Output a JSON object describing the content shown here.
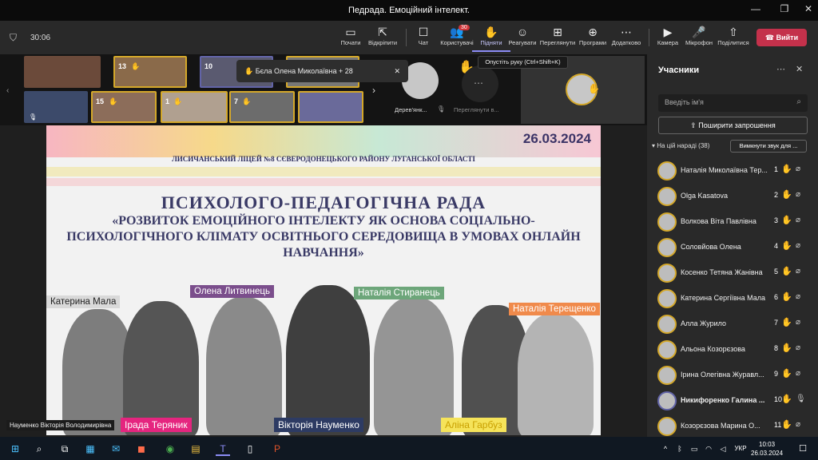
{
  "window": {
    "title": "Педрада. Емоційний інтелект.",
    "minimize": "—",
    "restore": "❐",
    "close": "✕"
  },
  "meeting": {
    "timer": "30:06"
  },
  "toolbar": {
    "items": [
      {
        "label": "Почати",
        "icon": "▭"
      },
      {
        "label": "Відкріпити",
        "icon": "⇱"
      },
      {
        "label": "Чат",
        "icon": "☐"
      },
      {
        "label": "Користувачі",
        "icon": "👥",
        "badge": "30"
      },
      {
        "label": "Підняти",
        "icon": "✋"
      },
      {
        "label": "Реагувати",
        "icon": "☺"
      },
      {
        "label": "Переглянути",
        "icon": "⊞"
      },
      {
        "label": "Програми",
        "icon": "⊕"
      },
      {
        "label": "Додатково",
        "icon": "⋯"
      },
      {
        "label": "Камера",
        "icon": "▶"
      },
      {
        "label": "Мікрофон",
        "icon": "🎤"
      },
      {
        "label": "Поділитися",
        "icon": "⇧"
      }
    ],
    "leave": "Вийти"
  },
  "strip": {
    "tiles": [
      {
        "count": ""
      },
      {
        "count": "13"
      },
      {
        "count": ""
      },
      {
        "count": "10"
      },
      {
        "count": ""
      },
      {
        "count": ""
      },
      {
        "count": "15"
      },
      {
        "count": "1"
      },
      {
        "count": "7"
      },
      {
        "count": ""
      }
    ],
    "toast": "Бєла Олена Миколаївна + 28",
    "tooltip": "Опустіть руку (Ctrl+Shift+K)",
    "person1": "Дерев'янк...",
    "person2": "Переглянути в..."
  },
  "slide": {
    "date": "26.03.2024",
    "school": "ЛИСИЧАНСЬКИЙ ЛІЦЕЙ №8 СЄВЕРОДОНЕЦЬКОГО РАЙОНУ ЛУГАНСЬКОЇ ОБЛАСТІ",
    "title": "ПСИХОЛОГО-ПЕДАГОГІЧНА РАДА",
    "subtitle": "«РОЗВИТОК ЕМОЦІЙНОГО ІНТЕЛЕКТУ ЯК ОСНОВА СОЦІАЛЬНО-ПСИХОЛОГІЧНОГО КЛІМАТУ ОСВІТНЬОГО СЕРЕДОВИЩА В УМОВАХ ОНЛАЙН НАВЧАННЯ»",
    "names": [
      "Катерина Мала",
      "Олена Литвинець",
      "Наталія Стиранець",
      "Наталія Терещенко",
      "Ірада Теряник",
      "Вікторія Науменко",
      "Аліна Гарбуз"
    ]
  },
  "presenter": "Науменко Вікторія Володимирівна",
  "sidebar": {
    "title": "Учасники",
    "search_placeholder": "Введіть ім'я",
    "share": "Поширити запрошення",
    "section": "На цій нараді (38)",
    "mute_all": "Вимкнути звук для ...",
    "participants": [
      {
        "name": "Наталія Миколаївна Тер...",
        "num": "1"
      },
      {
        "name": "Olga Kasatova",
        "num": "2"
      },
      {
        "name": "Волкова Віта Павлівна",
        "num": "3"
      },
      {
        "name": "Соловйова Олена",
        "num": "4"
      },
      {
        "name": "Косенко Тетяна Жанівна",
        "num": "5"
      },
      {
        "name": "Катерина Сергіївна Мала",
        "num": "6"
      },
      {
        "name": "Алла Журило",
        "num": "7"
      },
      {
        "name": "Альона Козорєзова",
        "num": "8"
      },
      {
        "name": "Ірина Олегівна Журавл...",
        "num": "9"
      },
      {
        "name": "Никифоренко Галина ...",
        "num": "10"
      },
      {
        "name": "Козорєзова Марина О...",
        "num": "11"
      }
    ]
  },
  "taskbar": {
    "time": "10:03",
    "date": "26.03.2024",
    "lang": "УКР"
  }
}
